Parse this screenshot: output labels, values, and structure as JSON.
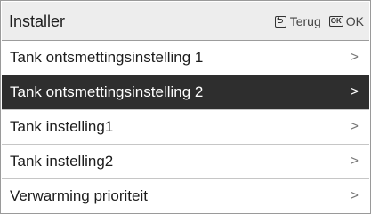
{
  "header": {
    "title": "Installer",
    "back_icon": "back-icon",
    "back_label": "Terug",
    "ok_icon_text": "OK",
    "ok_label": "OK"
  },
  "menu": {
    "selected_index": 1,
    "items": [
      {
        "label": "Tank ontsmettingsinstelling 1",
        "chevron": ">"
      },
      {
        "label": "Tank ontsmettingsinstelling 2",
        "chevron": ">"
      },
      {
        "label": "Tank instelling1",
        "chevron": ">"
      },
      {
        "label": "Tank instelling2",
        "chevron": ">"
      },
      {
        "label": "Verwarming prioriteit",
        "chevron": ">"
      }
    ]
  },
  "colors": {
    "header_bg": "#ededed",
    "selected_bg": "#2e2e2e",
    "selected_text": "#ffffff"
  }
}
